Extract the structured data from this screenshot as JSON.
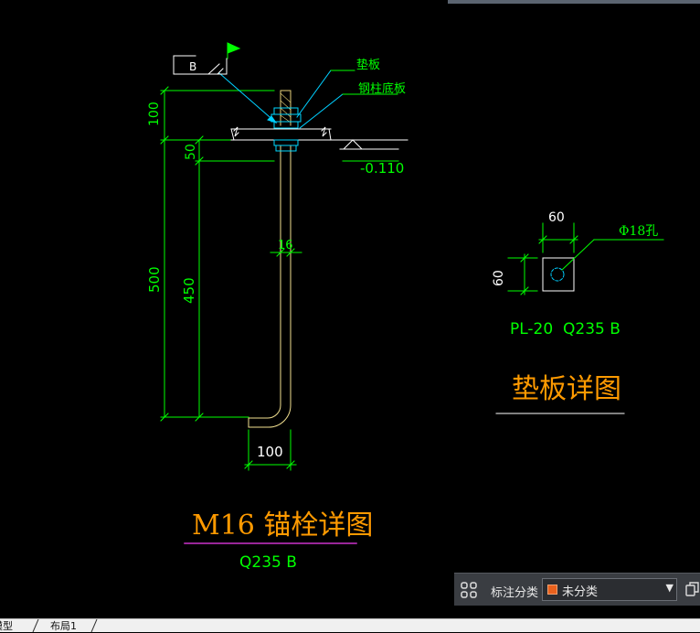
{
  "drawing": {
    "anchor_detail": {
      "section_mark": "B",
      "leader_labels": [
        "垫板",
        "钢柱底板"
      ],
      "level_value": "-0.110",
      "dims": {
        "top": "100",
        "upper": "50",
        "total": "500",
        "embed": "450",
        "dia": "16",
        "hook": "100"
      },
      "title": "M16 锚栓详图",
      "material": "Q235 B"
    },
    "plate_detail": {
      "width_dim": "60",
      "height_dim": "60",
      "hole_label": "Φ18孔",
      "spec": "PL-20  Q235 B",
      "title": "垫板详图"
    }
  },
  "annotation_bar": {
    "label": "标注分类",
    "value": "未分类",
    "swatch_color": "#e9611d"
  },
  "layout_tabs": [
    "模型",
    "布局1"
  ],
  "colors": {
    "background": "#000000",
    "geometry": "#ffffff",
    "dimension": "#00ff00",
    "title": "#ff9a00",
    "leader": "#00cfff",
    "underline_magenta": "#cc33cc",
    "anchor_bar": "#e8d27a",
    "nut": "#00d8ff"
  }
}
